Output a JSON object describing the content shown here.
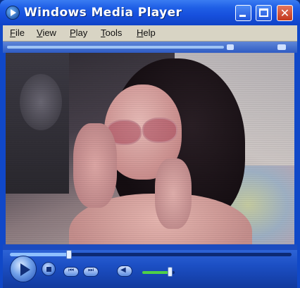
{
  "window": {
    "title": "Windows Media Player",
    "icon": "media-player-icon",
    "controls": {
      "minimize_icon": "minimize-icon",
      "maximize_icon": "maximize-icon",
      "close_icon": "close-icon",
      "close_glyph": "✕"
    }
  },
  "menu": {
    "items": [
      "File",
      "View",
      "Play",
      "Tools",
      "Help"
    ]
  },
  "video": {
    "content": "playing video frame"
  },
  "playback": {
    "seek_progress": 0.21,
    "volume_level": 0.85,
    "play_icon": "play-icon",
    "stop_icon": "stop-icon",
    "previous_icon": "previous-track-icon",
    "next_icon": "next-track-icon",
    "mute_icon": "speaker-icon"
  },
  "colors": {
    "titlebar": "#1f5fe6",
    "menubar": "#d8d4c4",
    "close_button": "#c3381c",
    "volume_fill": "#4fd046"
  }
}
